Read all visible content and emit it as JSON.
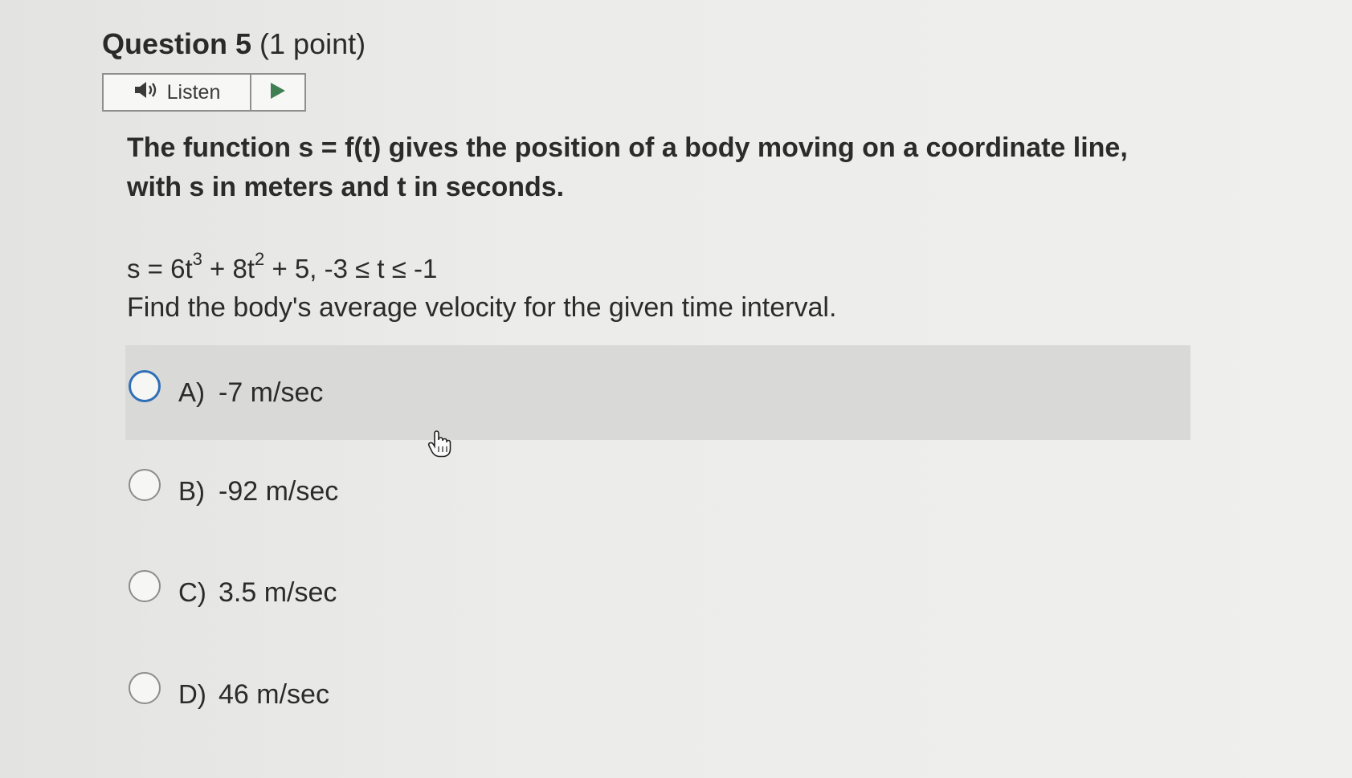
{
  "question": {
    "title": "Question 5",
    "points": "(1 point)"
  },
  "listen": {
    "label": "Listen",
    "speaker_icon": "speaker-icon",
    "play_icon": "play-icon"
  },
  "body": {
    "text": "The function s = f(t) gives the position of a body moving on a coordinate line, with s in meters and t in seconds.",
    "formula": {
      "part1": "s = 6t",
      "exp1": "3",
      "part2": " + 8t",
      "exp2": "2",
      "part3": " + 5, -3 ≤ t ≤ -1"
    },
    "prompt": "Find the body's average velocity for the given time interval."
  },
  "options": [
    {
      "letter": "A)",
      "text": "-7 m/sec"
    },
    {
      "letter": "B)",
      "text": "-92 m/sec"
    },
    {
      "letter": "C)",
      "text": "3.5 m/sec"
    },
    {
      "letter": "D)",
      "text": "46 m/sec"
    }
  ],
  "colors": {
    "focus_ring": "#2f6fb8",
    "highlight_row": "#d9d9d7"
  }
}
